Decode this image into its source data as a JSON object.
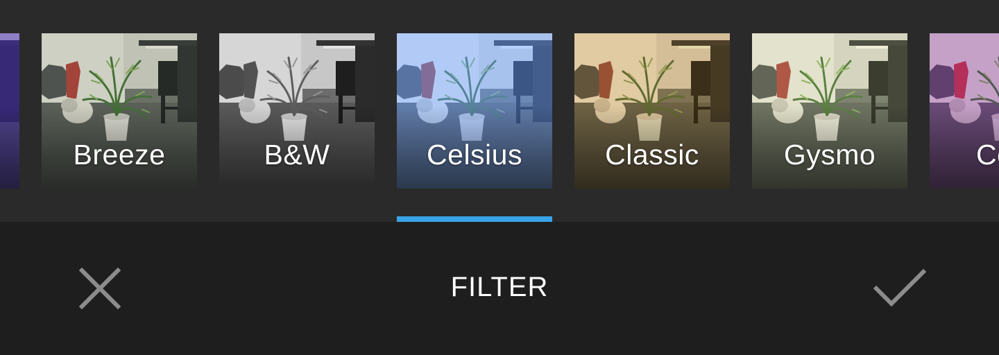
{
  "filters": [
    {
      "label": "",
      "tint": "rgba(70,40,210,0.45)"
    },
    {
      "label": "Breeze",
      "tint": "rgba(120,160,120,0.10)"
    },
    {
      "label": "B&W",
      "tint": "rgba(0,0,0,0)"
    },
    {
      "label": "Celsius",
      "tint": "rgba(90,150,255,0.45)"
    },
    {
      "label": "Classic",
      "tint": "rgba(150,110,40,0.28)"
    },
    {
      "label": "Gysmo",
      "tint": "rgba(180,190,110,0.18)"
    },
    {
      "label": "Co",
      "tint": "rgba(150,40,200,0.30)"
    }
  ],
  "selected_filter": "Celsius",
  "bottom_bar": {
    "title": "FILTER",
    "cancel_icon": "close-icon",
    "apply_icon": "check-icon"
  },
  "colors": {
    "strip_background": "#2a2a2a",
    "bar_background": "#1e1e1e",
    "accent": "#3aa3e8",
    "icon_gray": "#8c8c8c",
    "text": "#ffffff"
  }
}
